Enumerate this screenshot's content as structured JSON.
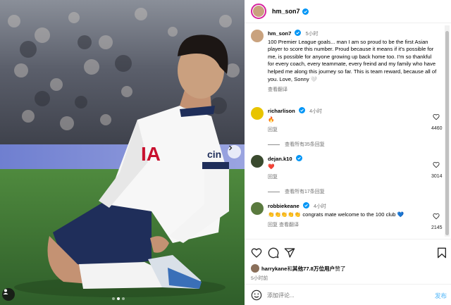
{
  "media": {
    "jersey_text_left": "IA",
    "jersey_text_right": "cin",
    "carousel_dots": 3,
    "active_dot": 1
  },
  "post": {
    "username": "hm_son7",
    "caption_username": "hm_son7",
    "caption_time": "5小时",
    "caption": "100 Premier League goals... man I am so proud to be the first Asian player to score this number. Proud because it means if it's possible for me, is possible for anyone growing up back home too. I'm so thankful for every coach, every teammate, every freind and my family who have helped me along this journey so far. This is team reward, because all of you. Love, Sonny 🤍",
    "see_translation": "查看翻译"
  },
  "comments": [
    {
      "username": "richarlison",
      "time": "4小时",
      "text": "🔥",
      "reply": "回复",
      "likes": "4460",
      "view_replies": "查看所有35条回复"
    },
    {
      "username": "dejan.k10",
      "time": "",
      "text": "❤️",
      "reply": "回复",
      "likes": "3014",
      "view_replies": "查看所有17条回复"
    },
    {
      "username": "robbiekeane",
      "time": "4小时",
      "text": "👏👏👏👏👏 congrats mate welcome to the 100 club 💙",
      "reply": "回复  查看翻译",
      "likes": "2145"
    }
  ],
  "footer": {
    "liked_by_user": "harrykane",
    "liked_by_rest": "和",
    "liked_by_others": "其他77.8万位用户",
    "liked_by_suffix": "赞了",
    "time_ago": "5小时前",
    "comment_placeholder": "添加评论...",
    "post_button": "发布"
  },
  "colors": {
    "verified_blue": "#0095f6",
    "like_red": "#ed4956",
    "muted_text": "#737373"
  },
  "icons": [
    "verified-badge-icon",
    "heart-icon",
    "comment-icon",
    "share-icon",
    "bookmark-icon",
    "emoji-icon",
    "chevron-right-icon",
    "user-tag-icon"
  ]
}
